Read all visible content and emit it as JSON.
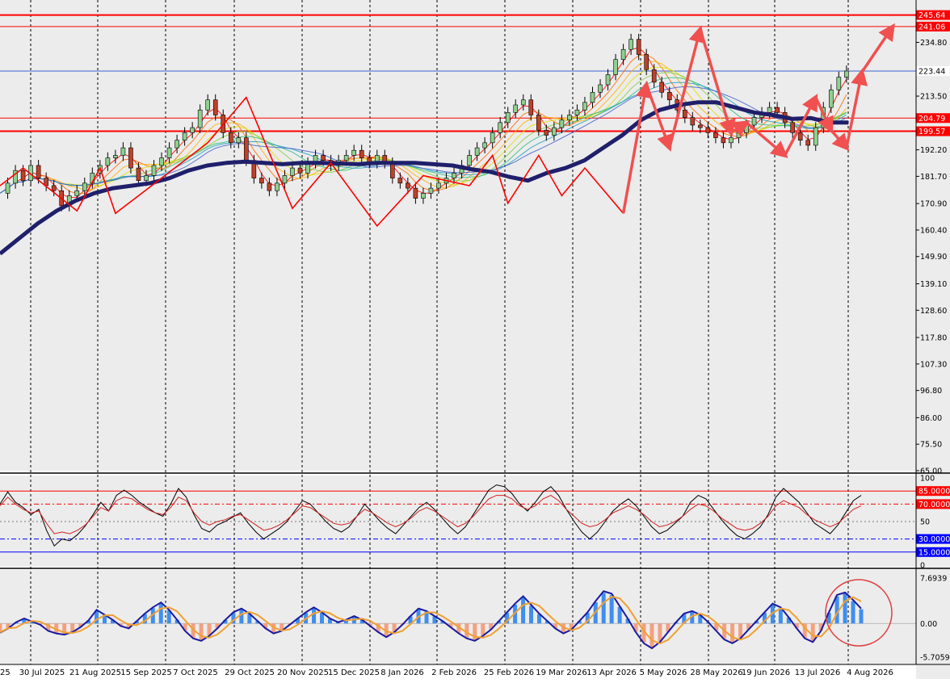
{
  "colors": {
    "bg": "#ececec",
    "ma_thick": "#1f1f6b",
    "red_lines": "#ff0000",
    "blue_line": "#3a5fd0",
    "arrow": "#f05050",
    "hist_pos": "#3f8ef0",
    "hist_neg": "#f4a080",
    "macd_line": "#1a1aa0",
    "signal_line": "#f0a030"
  },
  "chart_data": [
    {
      "type": "line",
      "panel": "price",
      "x_tick_labels": [
        "30 Jul 2025",
        "21 Aug 2025",
        "15 Sep 2025",
        "7 Oct 2025",
        "29 Oct 2025",
        "20 Nov 2025",
        "15 Dec 2025",
        "8 Jan 2026",
        "2 Feb 2026",
        "25 Feb 2026",
        "19 Mar 2026",
        "13 Apr 2026",
        "5 May 2026",
        "28 May 2026",
        "19 Jun 2026",
        "13 Jul 2026",
        "4 Aug 2026"
      ],
      "x_edge_label": "25",
      "y_tick_labels": [
        "234.80",
        "213.50",
        "192.20",
        "181.70",
        "170.90",
        "160.40",
        "149.90",
        "139.10",
        "128.60",
        "117.80",
        "107.30",
        "96.80",
        "86.00",
        "75.50",
        "65.00"
      ],
      "ylim": [
        65.0,
        250.0
      ],
      "horizontal_levels": [
        {
          "label": "245.64",
          "value": 245.64,
          "kind": "resistance"
        },
        {
          "label": "241.06",
          "value": 241.06,
          "kind": "resistance"
        },
        {
          "label": "223.44",
          "value": 223.44,
          "kind": "current"
        },
        {
          "label": "204.79",
          "value": 204.79,
          "kind": "support"
        },
        {
          "label": "199.57",
          "value": 199.57,
          "kind": "support"
        }
      ],
      "moving_average": [
        [
          0,
          151
        ],
        [
          1,
          157
        ],
        [
          2,
          163
        ],
        [
          3,
          168
        ],
        [
          4,
          172
        ],
        [
          5,
          175
        ],
        [
          6,
          177
        ],
        [
          7,
          178
        ],
        [
          8,
          179
        ],
        [
          9,
          181
        ],
        [
          10,
          184
        ],
        [
          11,
          186
        ],
        [
          12,
          187
        ],
        [
          13,
          187.5
        ],
        [
          14,
          187
        ],
        [
          15,
          186.5
        ],
        [
          16,
          187
        ],
        [
          17,
          187
        ],
        [
          18,
          186.8
        ],
        [
          19,
          186.5
        ],
        [
          20,
          187
        ],
        [
          21,
          187
        ],
        [
          22,
          187
        ],
        [
          23,
          186.5
        ],
        [
          24,
          186
        ],
        [
          25,
          184.5
        ],
        [
          26,
          183.5
        ],
        [
          27,
          181.5
        ],
        [
          28,
          180
        ],
        [
          29,
          183
        ],
        [
          30,
          185
        ],
        [
          31,
          188
        ],
        [
          32,
          193
        ],
        [
          33,
          198
        ],
        [
          34,
          204
        ],
        [
          35,
          208
        ],
        [
          36,
          210
        ],
        [
          37,
          211
        ],
        [
          38,
          211
        ],
        [
          39,
          209
        ],
        [
          40,
          207
        ],
        [
          41,
          206
        ],
        [
          42,
          204.5
        ],
        [
          43,
          204.8
        ],
        [
          44,
          203
        ],
        [
          45,
          203
        ]
      ],
      "price_path": [
        [
          0,
          175
        ],
        [
          1,
          179
        ],
        [
          2,
          184
        ],
        [
          3,
          180
        ],
        [
          4,
          186
        ],
        [
          5,
          181
        ],
        [
          6,
          178
        ],
        [
          7,
          176
        ],
        [
          8,
          170
        ],
        [
          9,
          174
        ],
        [
          10,
          176
        ],
        [
          11,
          179
        ],
        [
          12,
          183
        ],
        [
          13,
          186
        ],
        [
          14,
          189
        ],
        [
          15,
          190
        ],
        [
          16,
          193
        ],
        [
          17,
          185
        ],
        [
          18,
          180
        ],
        [
          19,
          182
        ],
        [
          20,
          186
        ],
        [
          21,
          189
        ],
        [
          22,
          193
        ],
        [
          23,
          196
        ],
        [
          24,
          199
        ],
        [
          25,
          201
        ],
        [
          26,
          208
        ],
        [
          27,
          212
        ],
        [
          28,
          206
        ],
        [
          29,
          199
        ],
        [
          30,
          195
        ],
        [
          31,
          197
        ],
        [
          32,
          188
        ],
        [
          33,
          181
        ],
        [
          34,
          179
        ],
        [
          35,
          176
        ],
        [
          36,
          179
        ],
        [
          37,
          182
        ],
        [
          38,
          185
        ],
        [
          39,
          183
        ],
        [
          40,
          187
        ],
        [
          41,
          190
        ],
        [
          42,
          188
        ],
        [
          43,
          186
        ],
        [
          44,
          188
        ],
        [
          45,
          190
        ],
        [
          46,
          192
        ],
        [
          47,
          189
        ],
        [
          48,
          187
        ],
        [
          49,
          190
        ],
        [
          50,
          187
        ],
        [
          51,
          181
        ],
        [
          52,
          179
        ],
        [
          53,
          177
        ],
        [
          54,
          173
        ],
        [
          55,
          175
        ],
        [
          56,
          177
        ],
        [
          57,
          179
        ],
        [
          58,
          181
        ],
        [
          59,
          183
        ],
        [
          60,
          186
        ],
        [
          61,
          190
        ],
        [
          62,
          193
        ],
        [
          63,
          195
        ],
        [
          64,
          199
        ],
        [
          65,
          203
        ],
        [
          66,
          207
        ],
        [
          67,
          210
        ],
        [
          68,
          212
        ],
        [
          69,
          206
        ],
        [
          70,
          200
        ],
        [
          71,
          198
        ],
        [
          72,
          201
        ],
        [
          73,
          204
        ],
        [
          74,
          206
        ],
        [
          75,
          208
        ],
        [
          76,
          211
        ],
        [
          77,
          215
        ],
        [
          78,
          218
        ],
        [
          79,
          222
        ],
        [
          80,
          228
        ],
        [
          81,
          232
        ],
        [
          82,
          236
        ],
        [
          83,
          230
        ],
        [
          84,
          224
        ],
        [
          85,
          219
        ],
        [
          86,
          215
        ],
        [
          87,
          212
        ],
        [
          88,
          208
        ],
        [
          89,
          205
        ],
        [
          90,
          202
        ],
        [
          91,
          201
        ],
        [
          92,
          199
        ],
        [
          93,
          197
        ],
        [
          94,
          195
        ],
        [
          95,
          197
        ],
        [
          96,
          199
        ],
        [
          97,
          202
        ],
        [
          98,
          205
        ],
        [
          99,
          207
        ],
        [
          100,
          209
        ],
        [
          101,
          207
        ],
        [
          102,
          203
        ],
        [
          103,
          199
        ],
        [
          104,
          196
        ],
        [
          105,
          194
        ],
        [
          106,
          201
        ],
        [
          107,
          209
        ],
        [
          108,
          216
        ],
        [
          109,
          221
        ],
        [
          110,
          223.44
        ]
      ],
      "zigzag_pivots": [
        [
          0,
          178
        ],
        [
          3,
          185
        ],
        [
          10,
          168
        ],
        [
          13,
          185
        ],
        [
          15,
          167
        ],
        [
          21,
          181
        ],
        [
          27,
          195
        ],
        [
          32,
          213
        ],
        [
          38,
          169
        ],
        [
          43,
          187
        ],
        [
          49,
          162
        ],
        [
          55,
          182
        ],
        [
          61,
          178
        ],
        [
          64,
          190
        ],
        [
          66,
          171
        ],
        [
          70,
          190
        ],
        [
          73,
          174
        ],
        [
          76,
          185
        ],
        [
          81,
          167
        ]
      ],
      "arrows": [
        {
          "from": [
            81,
            167
          ],
          "to": [
            84,
            218
          ]
        },
        {
          "from": [
            84,
            218
          ],
          "to": [
            87,
            193
          ]
        },
        {
          "from": [
            87,
            193
          ],
          "to": [
            91,
            240
          ]
        },
        {
          "from": [
            91,
            240
          ],
          "to": [
            95,
            199
          ]
        },
        {
          "from": [
            95,
            199
          ],
          "to": [
            97,
            203
          ]
        },
        {
          "from": [
            97,
            203
          ],
          "to": [
            102,
            190
          ]
        },
        {
          "from": [
            102,
            190
          ],
          "to": [
            106,
            213
          ]
        },
        {
          "from": [
            106,
            213
          ],
          "to": [
            108,
            200
          ]
        },
        {
          "from": [
            108,
            200
          ],
          "to": [
            110,
            193
          ]
        },
        {
          "from": [
            110,
            193
          ],
          "to": [
            112,
            223
          ]
        },
        {
          "from": [
            112,
            223
          ],
          "to": [
            116,
            241
          ]
        }
      ]
    },
    {
      "type": "line",
      "panel": "stochastic",
      "y_tick_labels": [
        "100",
        "50",
        "0"
      ],
      "levels": [
        {
          "label": "85.0000",
          "value": 85
        },
        {
          "label": "70.0000",
          "value": 70
        },
        {
          "label": "30.0000",
          "value": 30
        },
        {
          "label": "15.0000",
          "value": 15
        }
      ],
      "ylim": [
        0,
        100
      ],
      "series": [
        {
          "values": [
            70,
            84,
            72,
            66,
            58,
            64,
            40,
            22,
            30,
            28,
            35,
            45,
            58,
            72,
            62,
            80,
            86,
            80,
            72,
            66,
            60,
            56,
            70,
            88,
            78,
            58,
            42,
            38,
            46,
            50,
            55,
            60,
            48,
            38,
            30,
            36,
            42,
            50,
            62,
            74,
            70,
            60,
            50,
            42,
            38,
            44,
            56,
            70,
            60,
            50,
            42,
            36,
            46,
            56,
            66,
            72,
            64,
            54,
            44,
            36,
            44,
            58,
            72,
            86,
            92,
            90,
            82,
            70,
            62,
            72,
            84,
            90,
            80,
            64,
            50,
            38,
            30,
            38,
            50,
            62,
            70,
            76,
            68,
            56,
            44,
            36,
            40,
            48,
            56,
            72,
            80,
            76,
            64,
            52,
            42,
            34,
            30,
            36,
            44,
            58,
            78,
            88,
            80,
            72,
            60,
            48,
            42,
            36,
            46,
            60,
            74,
            80
          ]
        },
        {
          "values": [
            68,
            78,
            70,
            64,
            60,
            62,
            48,
            36,
            38,
            36,
            40,
            46,
            56,
            66,
            62,
            74,
            78,
            76,
            70,
            64,
            60,
            58,
            66,
            78,
            74,
            60,
            50,
            46,
            50,
            52,
            56,
            58,
            52,
            46,
            40,
            42,
            46,
            52,
            60,
            68,
            66,
            60,
            54,
            48,
            46,
            48,
            56,
            64,
            60,
            54,
            48,
            44,
            48,
            54,
            62,
            66,
            62,
            56,
            50,
            44,
            48,
            56,
            66,
            76,
            80,
            80,
            76,
            68,
            64,
            68,
            76,
            80,
            74,
            64,
            56,
            48,
            44,
            46,
            52,
            60,
            64,
            68,
            64,
            58,
            50,
            44,
            46,
            50,
            56,
            64,
            70,
            68,
            62,
            54,
            48,
            42,
            40,
            42,
            48,
            56,
            68,
            74,
            70,
            66,
            58,
            52,
            48,
            44,
            48,
            56,
            64,
            68
          ]
        }
      ]
    },
    {
      "type": "bar",
      "panel": "macd",
      "y_tick_labels": [
        "7.6939",
        "0.00",
        "-5.7059"
      ],
      "ylim": [
        -5.7059,
        7.6939
      ],
      "histogram": [
        -1.5,
        -0.8,
        0.2,
        0.8,
        0.3,
        -0.2,
        -1.2,
        -1.6,
        -1.8,
        -1.4,
        -0.6,
        0.5,
        2.2,
        1.4,
        0.6,
        -0.4,
        -0.8,
        0.4,
        1.6,
        2.6,
        3.4,
        2.2,
        0.6,
        -1.2,
        -2.4,
        -2.8,
        -2.0,
        -0.8,
        0.6,
        1.8,
        2.4,
        1.6,
        0.4,
        -0.8,
        -1.6,
        -1.2,
        -0.2,
        0.8,
        1.8,
        2.6,
        1.8,
        0.8,
        0.2,
        0.6,
        1.2,
        0.6,
        -0.4,
        -1.4,
        -2.2,
        -1.4,
        -0.2,
        1.2,
        2.4,
        2.0,
        1.2,
        0.4,
        -0.6,
        -1.6,
        -2.4,
        -2.8,
        -2.0,
        -1.0,
        0.4,
        1.8,
        3.2,
        4.4,
        3.0,
        1.6,
        0.4,
        -0.8,
        -1.6,
        -1.0,
        0.4,
        1.8,
        3.6,
        5.2,
        4.8,
        2.8,
        0.8,
        -1.4,
        -3.2,
        -4.0,
        -3.0,
        -1.4,
        0.2,
        1.6,
        2.0,
        1.4,
        0.2,
        -1.2,
        -2.6,
        -3.2,
        -2.4,
        -1.0,
        0.4,
        1.8,
        3.2,
        2.6,
        1.0,
        -0.8,
        -2.4,
        -3.0,
        -1.2,
        1.8,
        4.6,
        5.0,
        3.8,
        2.4
      ]
    }
  ]
}
